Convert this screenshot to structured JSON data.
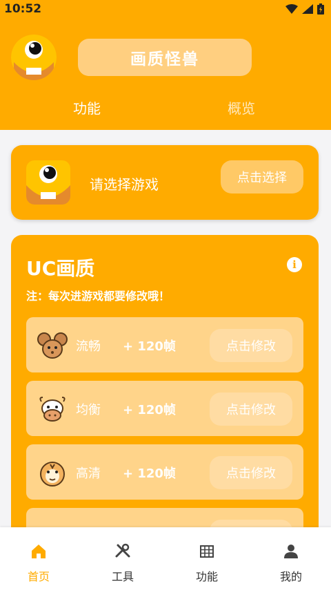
{
  "status_bar": {
    "time": "10:52"
  },
  "header": {
    "app_title": "画质怪兽",
    "tabs": [
      {
        "label": "功能"
      },
      {
        "label": "概览"
      }
    ]
  },
  "game_select": {
    "prompt": "请选择游戏",
    "button_label": "点击选择"
  },
  "uc_card": {
    "title": "UC画质",
    "info_glyph": "i",
    "note": "注：每次进游戏都要修改哦！",
    "rows": [
      {
        "name": "流畅",
        "fps": "+ 120帧",
        "button_label": "点击修改",
        "icon": "mouse-icon"
      },
      {
        "name": "均衡",
        "fps": "+ 120帧",
        "button_label": "点击修改",
        "icon": "cow-icon"
      },
      {
        "name": "高清",
        "fps": "+ 120帧",
        "button_label": "点击修改",
        "icon": "tiger-icon"
      }
    ]
  },
  "bottom_nav": [
    {
      "label": "首页",
      "icon": "home-icon",
      "active": true
    },
    {
      "label": "工具",
      "icon": "tools-icon",
      "active": false
    },
    {
      "label": "功能",
      "icon": "grid-icon",
      "active": false
    },
    {
      "label": "我的",
      "icon": "user-icon",
      "active": false
    }
  ],
  "colors": {
    "accent": "#ffab00",
    "pill": "#ffcf80",
    "row": "#ffd48a"
  }
}
